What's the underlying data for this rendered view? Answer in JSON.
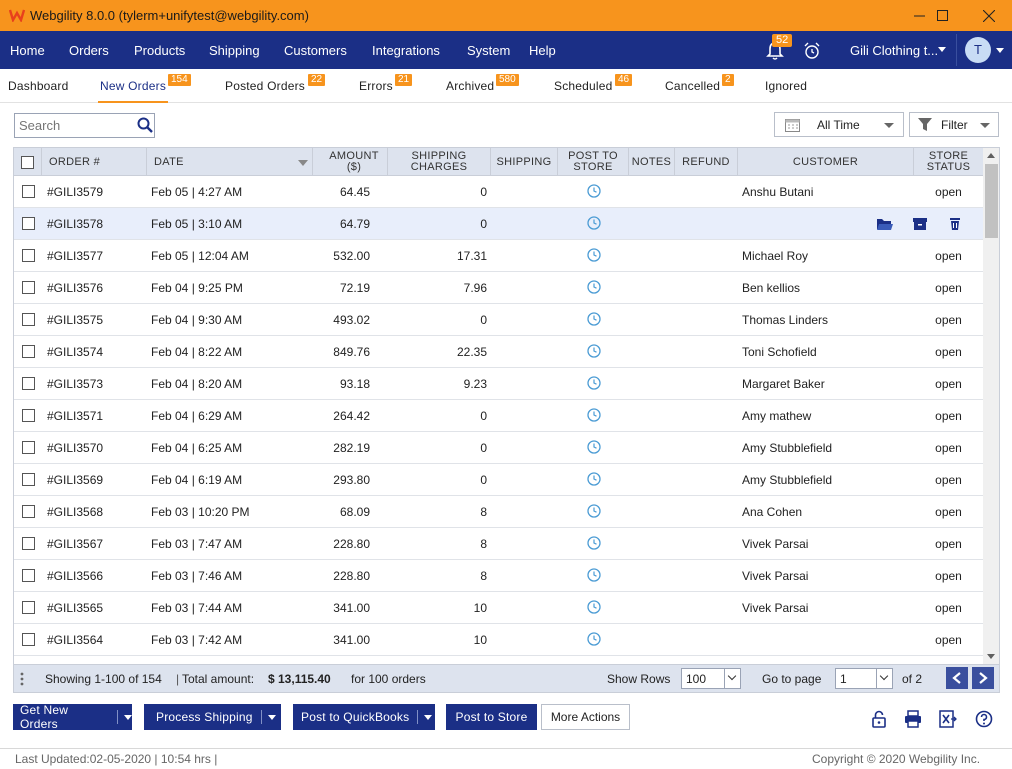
{
  "window": {
    "title": "Webgility 8.0.0 (tylerm+unifytest@webgility.com)",
    "minimize": "—",
    "maximize": "☐",
    "close": "✕",
    "logo_icon": "webgility-logo-icon"
  },
  "nav": {
    "items": [
      "Home",
      "Orders",
      "Products",
      "Shipping",
      "Customers",
      "Integrations",
      "System",
      "Help"
    ],
    "notification_count": "52",
    "store_name": "Gili Clothing t...",
    "avatar_initial": "T"
  },
  "tabs": [
    {
      "label": "Dashboard",
      "badge": ""
    },
    {
      "label": "New Orders",
      "badge": "154"
    },
    {
      "label": "Posted Orders",
      "badge": "22"
    },
    {
      "label": "Errors",
      "badge": "21"
    },
    {
      "label": "Archived",
      "badge": "580"
    },
    {
      "label": "Scheduled",
      "badge": "46"
    },
    {
      "label": "Cancelled",
      "badge": "2"
    },
    {
      "label": "Ignored",
      "badge": ""
    }
  ],
  "toolbar": {
    "search_placeholder": "Search",
    "date_range": "All Time",
    "filter_label": "Filter"
  },
  "columns": {
    "order": "ORDER #",
    "date": "DATE",
    "amount": "AMOUNT ($)",
    "shipping_charges": "SHIPPING CHARGES",
    "shipping": "SHIPPING",
    "post_to_store": "POST TO STORE",
    "notes": "NOTES",
    "refund": "REFUND",
    "customer": "CUSTOMER",
    "store_status": "STORE STATUS"
  },
  "orders": [
    {
      "order": "#GILI3579",
      "date": "Feb 05 | 4:27 AM",
      "amount": "64.45",
      "shipping_charges": "0",
      "customer": "Anshu Butani",
      "status": "open"
    },
    {
      "order": "#GILI3578",
      "date": "Feb 05 | 3:10 AM",
      "amount": "64.79",
      "shipping_charges": "0",
      "customer": "",
      "status": ""
    },
    {
      "order": "#GILI3577",
      "date": "Feb 05 | 12:04 AM",
      "amount": "532.00",
      "shipping_charges": "17.31",
      "customer": "Michael Roy",
      "status": "open"
    },
    {
      "order": "#GILI3576",
      "date": "Feb 04 | 9:25 PM",
      "amount": "72.19",
      "shipping_charges": "7.96",
      "customer": "Ben kellios",
      "status": "open"
    },
    {
      "order": "#GILI3575",
      "date": "Feb 04 | 9:30 AM",
      "amount": "493.02",
      "shipping_charges": "0",
      "customer": "Thomas Linders",
      "status": "open"
    },
    {
      "order": "#GILI3574",
      "date": "Feb 04 | 8:22 AM",
      "amount": "849.76",
      "shipping_charges": "22.35",
      "customer": "Toni Schofield",
      "status": "open"
    },
    {
      "order": "#GILI3573",
      "date": "Feb 04 | 8:20 AM",
      "amount": "93.18",
      "shipping_charges": "9.23",
      "customer": "Margaret Baker",
      "status": "open"
    },
    {
      "order": "#GILI3571",
      "date": "Feb 04 | 6:29 AM",
      "amount": "264.42",
      "shipping_charges": "0",
      "customer": "Amy mathew",
      "status": "open"
    },
    {
      "order": "#GILI3570",
      "date": "Feb 04 | 6:25 AM",
      "amount": "282.19",
      "shipping_charges": "0",
      "customer": "Amy Stubblefield",
      "status": "open"
    },
    {
      "order": "#GILI3569",
      "date": "Feb 04 | 6:19 AM",
      "amount": "293.80",
      "shipping_charges": "0",
      "customer": "Amy Stubblefield",
      "status": "open"
    },
    {
      "order": "#GILI3568",
      "date": "Feb 03 | 10:20 PM",
      "amount": "68.09",
      "shipping_charges": "8",
      "customer": "Ana Cohen",
      "status": "open"
    },
    {
      "order": "#GILI3567",
      "date": "Feb 03 | 7:47 AM",
      "amount": "228.80",
      "shipping_charges": "8",
      "customer": "Vivek Parsai",
      "status": "open"
    },
    {
      "order": "#GILI3566",
      "date": "Feb 03 | 7:46 AM",
      "amount": "228.80",
      "shipping_charges": "8",
      "customer": "Vivek Parsai",
      "status": "open"
    },
    {
      "order": "#GILI3565",
      "date": "Feb 03 | 7:44 AM",
      "amount": "341.00",
      "shipping_charges": "10",
      "customer": "Vivek Parsai",
      "status": "open"
    },
    {
      "order": "#GILI3564",
      "date": "Feb 03 | 7:42 AM",
      "amount": "341.00",
      "shipping_charges": "10",
      "customer": "",
      "status": "open"
    }
  ],
  "footer": {
    "showing": "Showing 1-100 of 154",
    "total_label": "Total amount:",
    "total_value": "$ 13,115.40",
    "total_suffix": "for 100 orders",
    "show_rows_label": "Show Rows",
    "show_rows_value": "100",
    "goto_label": "Go to page",
    "goto_value": "1",
    "of_pages": "of 2"
  },
  "actions": {
    "get_new_orders": "Get New Orders",
    "process_shipping": "Process Shipping",
    "post_to_quickbooks": "Post to QuickBooks",
    "post_to_store": "Post to Store",
    "more_actions": "More Actions"
  },
  "status": {
    "last_updated": "Last Updated:02-05-2020 | 10:54 hrs |",
    "copyright": "Copyright © 2020 Webgility Inc."
  },
  "colors": {
    "accent": "#f7941d",
    "nav": "#1b2f86",
    "clock": "#4a9bd4"
  }
}
